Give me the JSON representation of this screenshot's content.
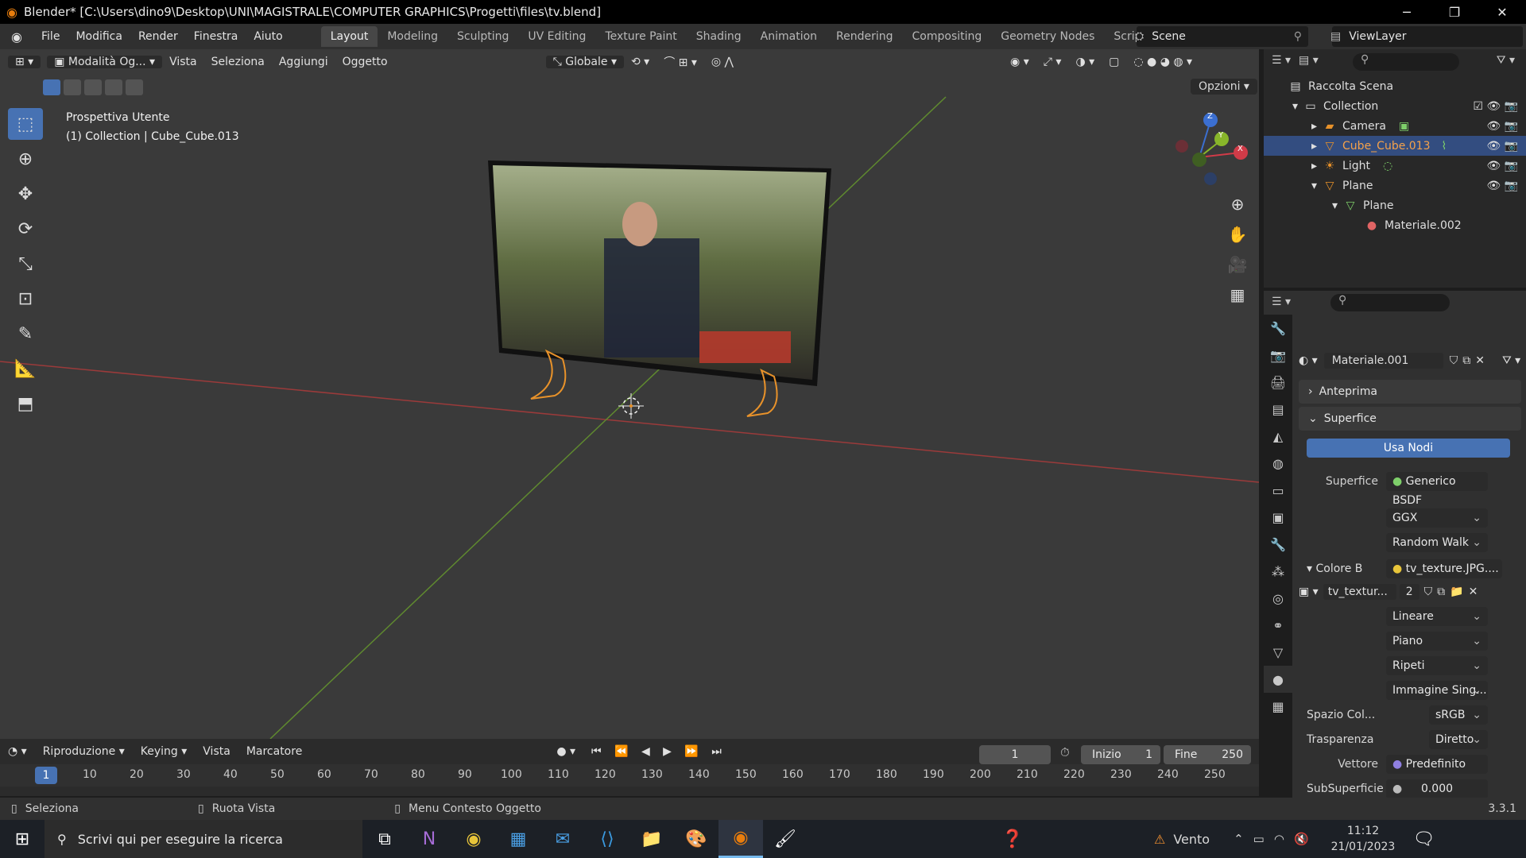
{
  "window": {
    "title": "Blender* [C:\\Users\\dino9\\Desktop\\UNI\\MAGISTRALE\\COMPUTER GRAPHICS\\Progetti\\files\\tv.blend]"
  },
  "menu": {
    "items": [
      "File",
      "Modifica",
      "Render",
      "Finestra",
      "Aiuto"
    ]
  },
  "workspaces": [
    "Layout",
    "Modeling",
    "Sculpting",
    "UV Editing",
    "Texture Paint",
    "Shading",
    "Animation",
    "Rendering",
    "Compositing",
    "Geometry Nodes",
    "Scripting"
  ],
  "scene": {
    "name": "Scene",
    "view_layer": "ViewLayer"
  },
  "viewport": {
    "mode": "Modalità Og...",
    "menus": [
      "Vista",
      "Seleziona",
      "Aggiungi",
      "Oggetto"
    ],
    "orientation": "Globale",
    "options_label": "Opzioni",
    "info_line1": "Prospettiva Utente",
    "info_line2": "(1) Collection | Cube_Cube.013",
    "axes": [
      "Z",
      "Y",
      "X"
    ]
  },
  "outliner": {
    "root": "Raccolta Scena",
    "rows": [
      {
        "label": "Collection"
      },
      {
        "label": "Camera"
      },
      {
        "label": "Cube_Cube.013"
      },
      {
        "label": "Light"
      },
      {
        "label": "Plane"
      },
      {
        "label": "Plane"
      },
      {
        "label": "Materiale.002"
      }
    ]
  },
  "properties": {
    "material_name": "Materiale.001",
    "panel_preview": "Anteprima",
    "panel_surface": "Superfice",
    "use_nodes": "Usa Nodi",
    "surface_label": "Superfice",
    "surface_value": "Generico BSDF",
    "distribution": "GGX",
    "subsurface_method": "Random Walk",
    "base_color_label": "Colore B",
    "base_color_value": "tv_texture.JPG....",
    "image_name": "tv_textur...",
    "image_users": "2",
    "interpolation": "Lineare",
    "projection": "Piano",
    "extension": "Ripeti",
    "source": "Immagine Sing...",
    "color_space_label": "Spazio Col...",
    "color_space_value": "sRGB",
    "alpha_label": "Trasparenza",
    "alpha_value": "Diretto",
    "vector_label": "Vettore",
    "vector_value": "Predefinito",
    "subsurface_label": "SubSuperficie",
    "subsurface_value": "0.000"
  },
  "timeline": {
    "menus": [
      "Riproduzione",
      "Keying",
      "Vista",
      "Marcatore"
    ],
    "current_frame": "1",
    "start_label": "Inizio",
    "start_value": "1",
    "end_label": "Fine",
    "end_value": "250",
    "ruler": [
      "1",
      "10",
      "20",
      "30",
      "40",
      "50",
      "60",
      "70",
      "80",
      "90",
      "100",
      "110",
      "120",
      "130",
      "140",
      "150",
      "160",
      "170",
      "180",
      "190",
      "200",
      "210",
      "220",
      "230",
      "240",
      "250"
    ]
  },
  "status": {
    "select": "Seleziona",
    "rotate": "Ruota Vista",
    "context": "Menu Contesto Oggetto",
    "version": "3.3.1"
  },
  "taskbar": {
    "search_placeholder": "Scrivi qui per eseguire la ricerca",
    "weather": "Vento",
    "time": "11:12",
    "date": "21/01/2023"
  }
}
